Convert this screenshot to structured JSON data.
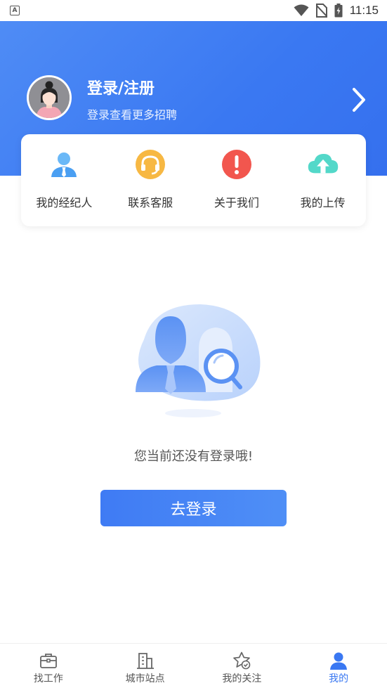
{
  "status_bar": {
    "app_glyph": "A",
    "time": "11:15",
    "icons": [
      "wifi-icon",
      "no-sim-icon",
      "battery-charging-icon"
    ]
  },
  "header": {
    "title": "登录/注册",
    "subtitle": "登录查看更多招聘",
    "avatar": "female-avatar",
    "arrow_icon": "chevron-right-icon",
    "background": "#3a78f2"
  },
  "quick_actions": [
    {
      "label": "我的经纪人",
      "icon": "agent-icon",
      "color": "#5aaaf5"
    },
    {
      "label": "联系客服",
      "icon": "headset-icon",
      "color": "#f6b13b"
    },
    {
      "label": "关于我们",
      "icon": "info-alert-icon",
      "color": "#f0554d"
    },
    {
      "label": "我的上传",
      "icon": "cloud-upload-icon",
      "color": "#4fd6c6"
    }
  ],
  "empty_state": {
    "illustration": "person-search-illustration",
    "message": "您当前还没有登录哦!",
    "button_label": "去登录"
  },
  "tabbar": {
    "active_color": "#3a78f2",
    "tabs": [
      {
        "label": "找工作",
        "icon": "briefcase-icon",
        "active": false
      },
      {
        "label": "城市站点",
        "icon": "building-icon",
        "active": false
      },
      {
        "label": "我的关注",
        "icon": "star-check-icon",
        "active": false
      },
      {
        "label": "我的",
        "icon": "user-icon",
        "active": true
      }
    ]
  }
}
